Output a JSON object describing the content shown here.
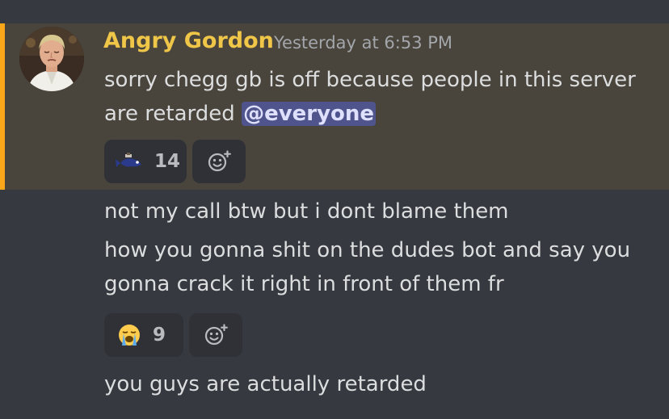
{
  "message_group": {
    "author": "Angry Gordon",
    "timestamp": "Yesterday at 6:53 PM",
    "first_message": {
      "text_line1": "sorry chegg gb is off because people in this server",
      "text_line2_prefix": "are retarded ",
      "mention": "@everyone",
      "highlight_color": "#faa81a",
      "reactions": [
        {
          "emoji": "custom-fish-emoji",
          "count": "14"
        }
      ],
      "add_reaction_icon": "add-reaction-icon"
    },
    "second_message": {
      "text": "not my call btw but i dont blame them"
    },
    "third_message": {
      "text_line1": "how you gonna shit on the dudes bot and say you",
      "text_line2": "gonna crack it right in front of them fr",
      "reactions": [
        {
          "emoji": "loudly-crying-face-emoji",
          "count": "9"
        }
      ],
      "add_reaction_icon": "add-reaction-icon"
    },
    "fourth_message": {
      "text": "you guys are actually retarded"
    }
  },
  "colors": {
    "background": "#36393f",
    "mention_background": "#49443c",
    "author_color": "#f0c649",
    "reaction_background": "#2f3136"
  }
}
